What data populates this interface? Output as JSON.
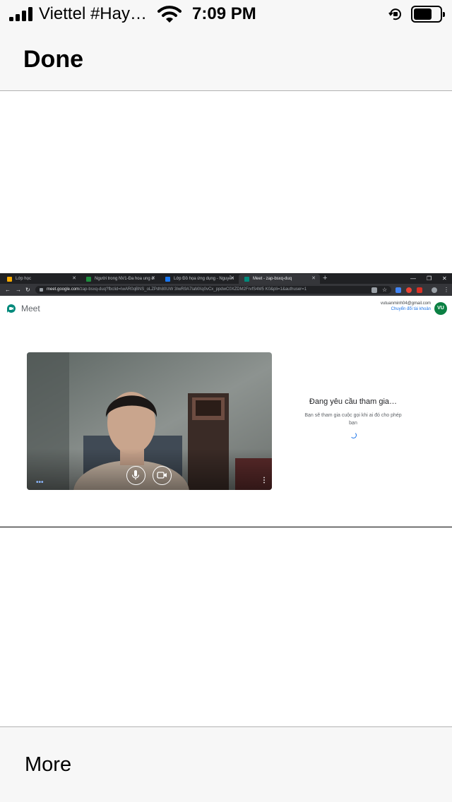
{
  "status_bar": {
    "carrier": "Viettel #Hay…",
    "time": "7:09 PM",
    "battery_level": 0.7
  },
  "nav": {
    "done_label": "Done"
  },
  "browser": {
    "tabs": [
      {
        "title": "Lớp học",
        "favicon_color": "#f9ab00"
      },
      {
        "title": "Người trong NV1-Đa hoa ung d",
        "favicon_color": "#1e8e3e"
      },
      {
        "title": "Lớp Đồ họa ứng dụng - Nguyễn",
        "favicon_color": "#1877f2"
      },
      {
        "title": "Meet - zap-bsxq-duq",
        "favicon_color": "#00897b"
      }
    ],
    "active_tab": 3,
    "url_host": "meet.google.com",
    "url_path": "/zap-bsxq-duq?fbclid=IwAR0qBNS_oLZPdh80UW 3IwR9A7IaMXq0vCx_ppdwC0XZDM2FrvfS4M5 K0&pli=1&authuser=1"
  },
  "meet": {
    "app_name": "Meet",
    "account_email": "vutuanminh04@gmail.com",
    "switch_account": "Chuyển đổi tài khoản",
    "avatar_initials": "VU",
    "status_title": "Đang yêu cầu tham gia…",
    "status_subtitle": "Bạn sẽ tham gia cuộc gọi khi ai đó cho phép bạn"
  },
  "bottom": {
    "more_label": "More"
  }
}
